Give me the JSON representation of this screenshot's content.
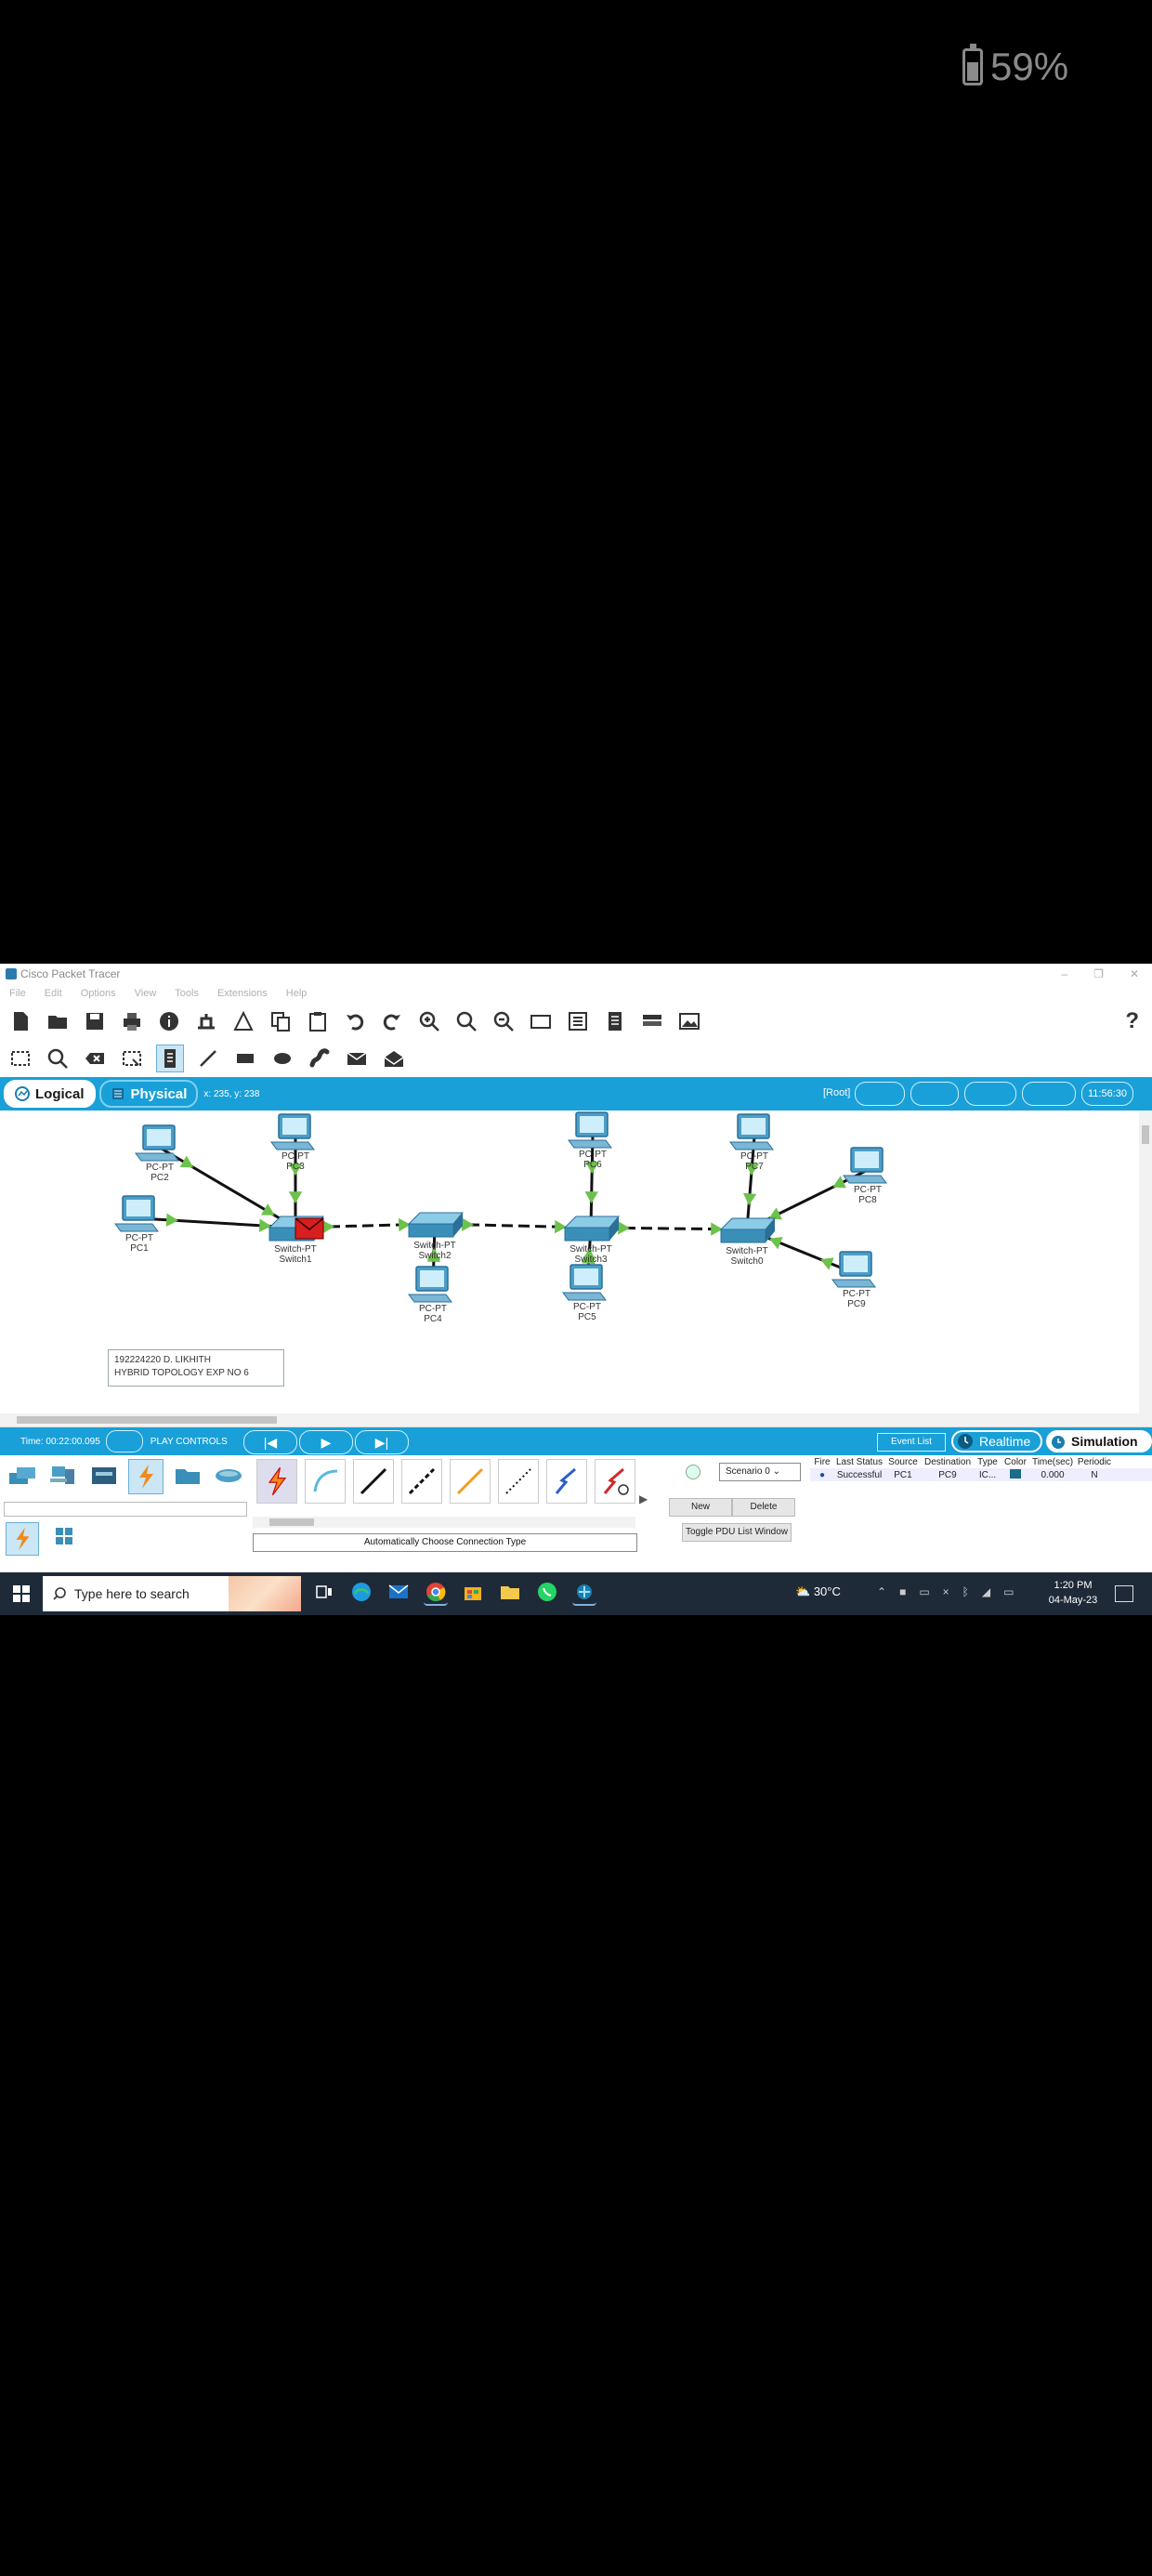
{
  "phone_status": {
    "battery_percent": "59%",
    "battery_level": 0.59
  },
  "window": {
    "title": "Cisco Packet Tracer",
    "menu": [
      "File",
      "Edit",
      "Options",
      "View",
      "Tools",
      "Extensions",
      "Help"
    ],
    "help_symbol": "?"
  },
  "mode_bar": {
    "logical_label": "Logical",
    "physical_label": "Physical",
    "coords": "x: 235, y: 238",
    "root_label": "[Root]",
    "clock": "11:56:30"
  },
  "topology": {
    "nodes": [
      {
        "id": "PC2",
        "type": "PC-PT",
        "name": "PC2"
      },
      {
        "id": "PC3",
        "type": "PC-PT",
        "name": "PC3"
      },
      {
        "id": "PC6",
        "type": "PC-PT",
        "name": "PC6"
      },
      {
        "id": "PC7",
        "type": "PC-PT",
        "name": "PC7"
      },
      {
        "id": "PC8",
        "type": "PC-PT",
        "name": "PC8"
      },
      {
        "id": "PC1",
        "type": "PC-PT",
        "name": "PC1"
      },
      {
        "id": "PC4",
        "type": "PC-PT",
        "name": "PC4"
      },
      {
        "id": "PC5",
        "type": "PC-PT",
        "name": "PC5"
      },
      {
        "id": "PC9",
        "type": "PC-PT",
        "name": "PC9"
      },
      {
        "id": "Switch1",
        "type": "Switch-PT",
        "name": "Switch1"
      },
      {
        "id": "Switch2",
        "type": "Switch-PT",
        "name": "Switch2"
      },
      {
        "id": "Switch3",
        "type": "Switch-PT",
        "name": "Switch3"
      },
      {
        "id": "Switch0",
        "type": "Switch-PT",
        "name": "Switch0"
      }
    ],
    "links": [
      {
        "from": "PC2",
        "to": "Switch1",
        "style": "solid"
      },
      {
        "from": "PC3",
        "to": "Switch1",
        "style": "solid"
      },
      {
        "from": "PC1",
        "to": "Switch1",
        "style": "solid"
      },
      {
        "from": "Switch1",
        "to": "Switch2",
        "style": "dashed"
      },
      {
        "from": "PC4",
        "to": "Switch2",
        "style": "solid"
      },
      {
        "from": "Switch2",
        "to": "Switch3",
        "style": "dashed"
      },
      {
        "from": "PC6",
        "to": "Switch3",
        "style": "solid"
      },
      {
        "from": "PC5",
        "to": "Switch3",
        "style": "solid"
      },
      {
        "from": "Switch3",
        "to": "Switch0",
        "style": "dashed"
      },
      {
        "from": "PC7",
        "to": "Switch0",
        "style": "solid"
      },
      {
        "from": "PC8",
        "to": "Switch0",
        "style": "solid"
      },
      {
        "from": "PC9",
        "to": "Switch0",
        "style": "solid"
      }
    ],
    "note_lines": [
      "192224220  D. LIKHITH",
      "HYBRID TOPOLOGY EXP NO 6"
    ]
  },
  "sim_bar": {
    "time": "Time: 00:22:00.095",
    "play_controls": "PLAY CONTROLS",
    "event_list": "Event List",
    "realtime": "Realtime",
    "simulation": "Simulation"
  },
  "connections": {
    "auto_label": "Automatically Choose Connection Type"
  },
  "scenario": {
    "selected": "Scenario 0",
    "new_label": "New",
    "delete_label": "Delete",
    "toggle_label": "Toggle PDU List Window"
  },
  "pdu_table": {
    "headers": [
      "Fire",
      "Last Status",
      "Source",
      "Destination",
      "Type",
      "Color",
      "Time(sec)",
      "Periodic"
    ],
    "rows": [
      {
        "fire": "",
        "status": "Successful",
        "source": "PC1",
        "destination": "PC9",
        "type": "IC...",
        "time": "0.000",
        "periodic": "N"
      }
    ],
    "color_swatch": "#1a6c8a"
  },
  "taskbar": {
    "search_placeholder": "Type here to search",
    "weather": "30°C",
    "time": "1:20 PM",
    "date": "04-May-23"
  },
  "colors": {
    "accent": "#19a0d8",
    "arrow_green": "#6cc24a",
    "envelope_red": "#d81e1e"
  }
}
